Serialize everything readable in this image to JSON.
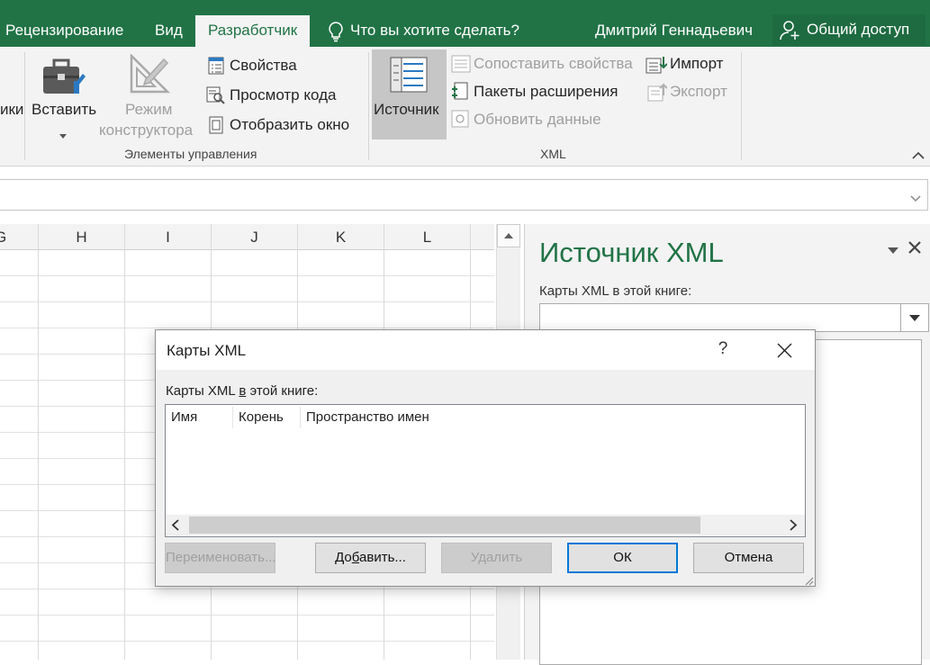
{
  "ribbon_tabs": {
    "review": "Рецензирование",
    "view": "Вид",
    "developer": "Разработчик",
    "tell_me": "Что вы хотите сделать?",
    "user": "Дмитрий Геннадьевич",
    "share": "Общий доступ"
  },
  "ribbon": {
    "partial_left": "ики",
    "controls": {
      "insert": "Вставить",
      "design_mode_1": "Режим",
      "design_mode_2": "конструктора",
      "properties": "Свойства",
      "view_code": "Просмотр кода",
      "run_dialog": "Отобразить окно",
      "group_label": "Элементы управления"
    },
    "xml": {
      "source": "Источник",
      "map_properties": "Сопоставить свойства",
      "expansion_packs": "Пакеты расширения",
      "refresh_data": "Обновить данные",
      "import": "Импорт",
      "export": "Экспорт",
      "group_label": "XML"
    }
  },
  "grid": {
    "partial_col": "G",
    "columns": [
      "H",
      "I",
      "J",
      "K",
      "L"
    ]
  },
  "task_pane": {
    "title": "Источник XML",
    "maps_label": "Карты XML в этой книге:"
  },
  "dialog": {
    "title": "Карты XML",
    "help": "?",
    "maps_label_pre": "Карты XML ",
    "maps_label_u": "в",
    "maps_label_post": " этой книге:",
    "columns": {
      "name": "Имя",
      "root": "Корень",
      "namespace": "Пространство имен"
    },
    "buttons": {
      "rename": "Переименовать...",
      "add_pre": "До",
      "add_u": "б",
      "add_post": "авить...",
      "delete": "Удалить",
      "ok": "ОК",
      "cancel": "Отмена"
    }
  },
  "colors": {
    "accent": "#217346",
    "ribbon_bg": "#f3f3f3",
    "focus": "#0078d7"
  }
}
